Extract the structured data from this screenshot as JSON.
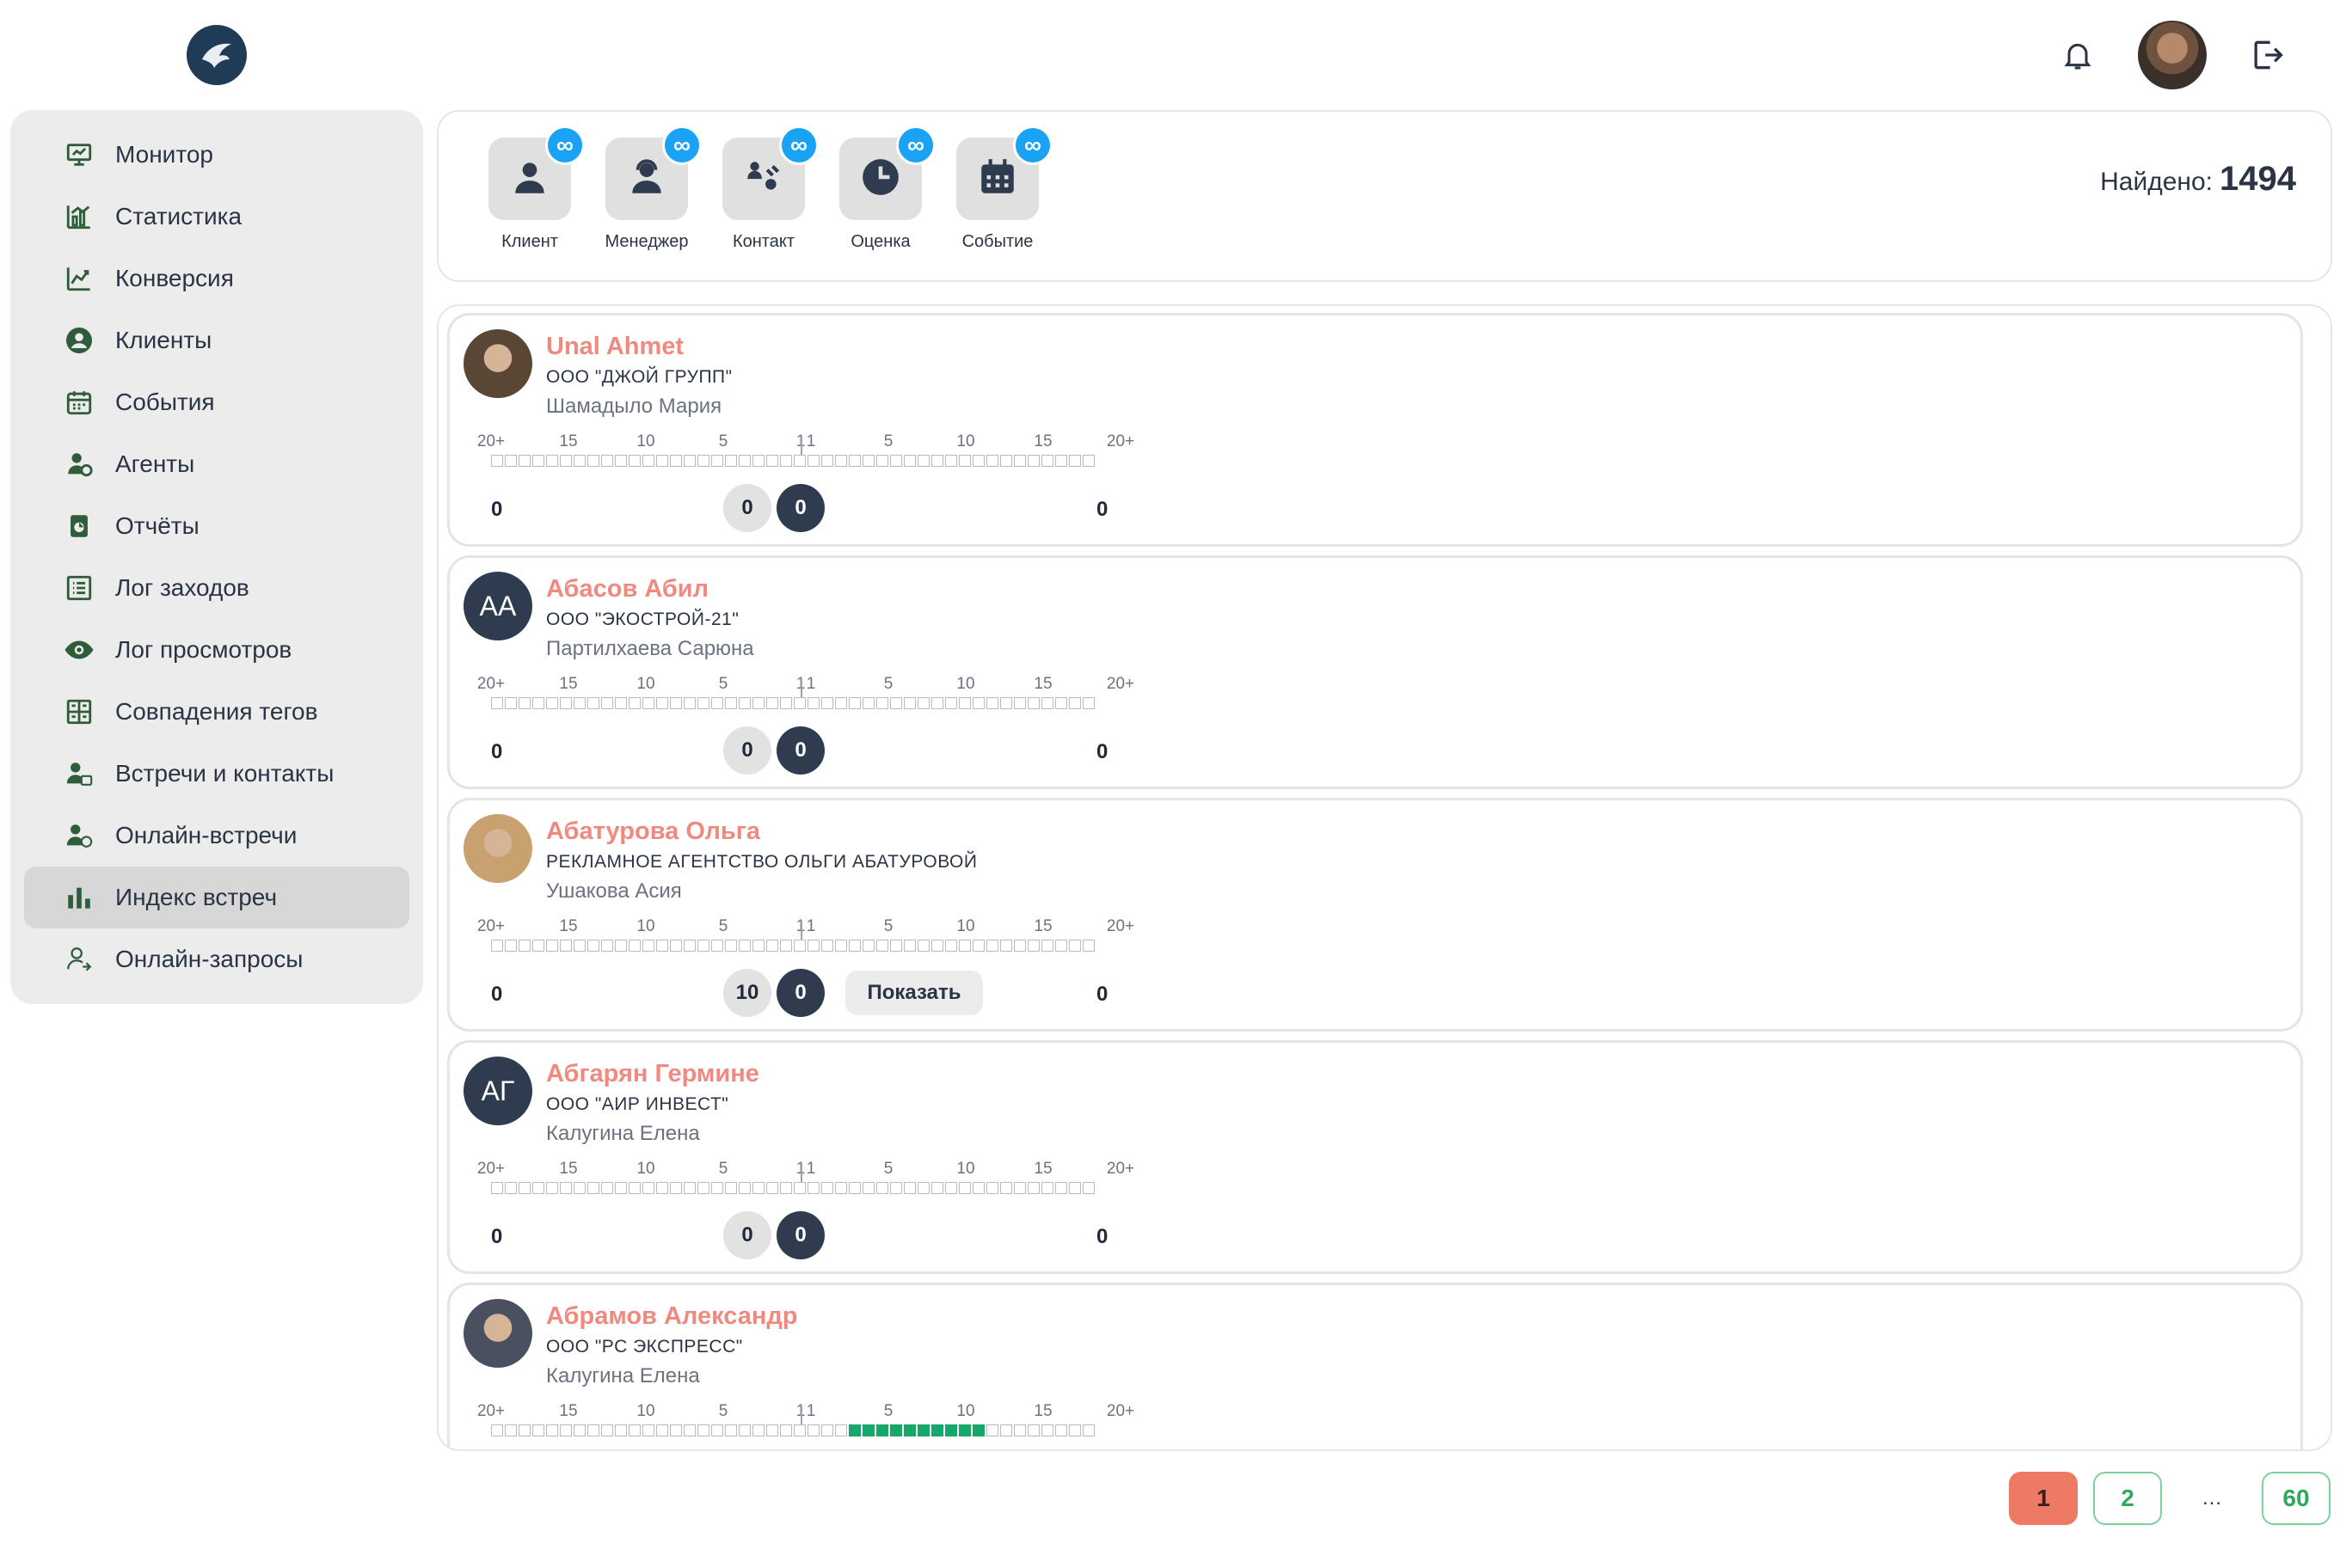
{
  "app": {
    "logo_name": "brand-logo"
  },
  "header": {
    "notifications_icon": "bell-icon",
    "logout_icon": "logout-icon"
  },
  "sidebar": {
    "items": [
      {
        "label": "Монитор",
        "icon": "monitor-icon"
      },
      {
        "label": "Статистика",
        "icon": "statistics-icon"
      },
      {
        "label": "Конверсия",
        "icon": "conversion-icon"
      },
      {
        "label": "Клиенты",
        "icon": "clients-icon"
      },
      {
        "label": "События",
        "icon": "calendar-icon"
      },
      {
        "label": "Агенты",
        "icon": "agents-icon"
      },
      {
        "label": "Отчёты",
        "icon": "reports-icon"
      },
      {
        "label": "Лог заходов",
        "icon": "list-icon"
      },
      {
        "label": "Лог просмотров",
        "icon": "eye-icon"
      },
      {
        "label": "Совпадения тегов",
        "icon": "tags-icon"
      },
      {
        "label": "Встречи и контакты",
        "icon": "meetings-icon"
      },
      {
        "label": "Онлайн-встречи",
        "icon": "online-meetings-icon"
      },
      {
        "label": "Индекс встреч",
        "icon": "bar-chart-icon"
      },
      {
        "label": "Онлайн-запросы",
        "icon": "online-requests-icon"
      }
    ],
    "active_index": 12
  },
  "filters": {
    "items": [
      {
        "label": "Клиент",
        "badge": "∞",
        "icon": "client-icon"
      },
      {
        "label": "Менеджер",
        "badge": "∞",
        "icon": "manager-icon"
      },
      {
        "label": "Контакт",
        "badge": "∞",
        "icon": "contact-icon"
      },
      {
        "label": "Оценка",
        "badge": "∞",
        "icon": "clock-icon"
      },
      {
        "label": "Событие",
        "badge": "∞",
        "icon": "event-icon"
      }
    ],
    "found_label": "Найдено:",
    "found_count": "1494"
  },
  "scale_labels": [
    "20+",
    "15",
    "10",
    "5",
    "1",
    "1",
    "5",
    "10",
    "15",
    "20+"
  ],
  "cards": [
    {
      "name": "Unal Ahmet",
      "company": "ООО \"ДЖОЙ ГРУПП\"",
      "manager": "Шамадыло Мария",
      "avatar_initials": "",
      "avatar_color": "#5a4634",
      "left_value": "0",
      "circle_light": "0",
      "circle_dark": "0",
      "right_value": "0",
      "show_button": "",
      "filled_squares": []
    },
    {
      "name": "Абасов Абил",
      "company": "ООО \"ЭКОСТРОЙ-21\"",
      "manager": "Партилхаева Сарюна",
      "avatar_initials": "АА",
      "avatar_color": "#2f3b4e",
      "left_value": "0",
      "circle_light": "0",
      "circle_dark": "0",
      "right_value": "0",
      "show_button": "",
      "filled_squares": []
    },
    {
      "name": "Абатурова Ольга",
      "company": "РЕКЛАМНОЕ АГЕНТСТВО ОЛЬГИ АБАТУРОВОЙ",
      "manager": "Ушакова Асия",
      "avatar_initials": "",
      "avatar_color": "#c9a070",
      "left_value": "0",
      "circle_light": "10",
      "circle_dark": "0",
      "right_value": "0",
      "show_button": "Показать",
      "filled_squares": []
    },
    {
      "name": "Абгарян Гермине",
      "company": "ООО \"АИР ИНВЕСТ\"",
      "manager": "Калугина Елена",
      "avatar_initials": "АГ",
      "avatar_color": "#2f3b4e",
      "left_value": "0",
      "circle_light": "0",
      "circle_dark": "0",
      "right_value": "0",
      "show_button": "",
      "filled_squares": []
    },
    {
      "name": "Абрамов Александр",
      "company": "ООО \"РС ЭКСПРЕСС\"",
      "manager": "Калугина Елена",
      "avatar_initials": "",
      "avatar_color": "#4a5060",
      "left_value": "",
      "circle_light": "",
      "circle_dark": "",
      "right_value": "",
      "show_button": "",
      "filled_squares": [
        26,
        27,
        28,
        29,
        30,
        31,
        32,
        33,
        34,
        35
      ]
    }
  ],
  "pagination": {
    "pages": [
      "1",
      "2",
      "…",
      "60"
    ],
    "active": "1"
  }
}
